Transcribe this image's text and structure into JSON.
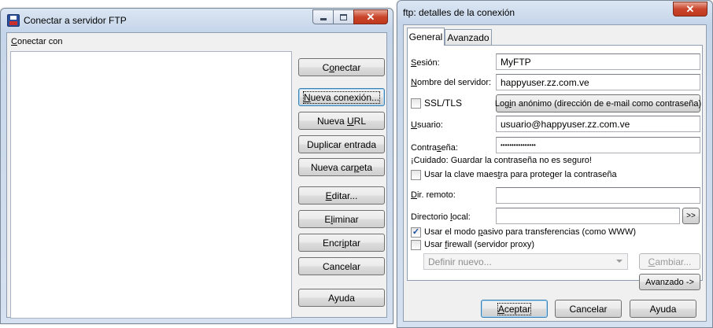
{
  "win1": {
    "title": "Conectar a servidor FTP",
    "connect_with_label_u": "C",
    "connect_with_label_rest": "onectar con",
    "buttons": {
      "connect": {
        "pre": "C",
        "u": "o",
        "post": "nectar"
      },
      "new_connection": {
        "pre": "",
        "u": "N",
        "post": "ueva conexión..."
      },
      "new_url": {
        "pre": "Nueva ",
        "u": "U",
        "post": "RL"
      },
      "duplicate": {
        "pre": "",
        "u": "",
        "post": "Duplicar entrada"
      },
      "new_folder": {
        "pre": "Nueva car",
        "u": "p",
        "post": "eta"
      },
      "edit": {
        "pre": "",
        "u": "E",
        "post": "ditar..."
      },
      "delete": {
        "pre": "E",
        "u": "l",
        "post": "iminar"
      },
      "encrypt": {
        "pre": "Encr",
        "u": "i",
        "post": "ptar"
      },
      "cancel": {
        "pre": "",
        "u": "",
        "post": "Cancelar"
      },
      "help": {
        "pre": "",
        "u": "",
        "post": "Ayuda"
      }
    }
  },
  "win2": {
    "title": "ftp: detalles de la conexión",
    "tabs": {
      "general": "General",
      "advanced": "Avanzado"
    },
    "session": {
      "label_u": "S",
      "label_rest": "esión:",
      "value": "MyFTP"
    },
    "server": {
      "label_u": "N",
      "label_rest": "ombre del servidor:",
      "value": "happyuser.zz.com.ve"
    },
    "ssl": {
      "label": "SSL/TLS",
      "checked": false
    },
    "anon_button": {
      "pre": "Log",
      "u": "i",
      "post": "n anónimo (dirección de e-mail como contraseña)"
    },
    "user": {
      "label_u": "U",
      "label_rest": "suario:",
      "value": "usuario@happyuser.zz.com.ve"
    },
    "password": {
      "label_pre": "Contra",
      "label_u": "s",
      "label_post": "eña:",
      "value": "••••••••••••••••"
    },
    "warning": "¡Cuidado: Guardar la contraseña no es seguro!",
    "master_key": {
      "pre": "Usar la clave maes",
      "u": "t",
      "post": "ra para proteger la contraseña",
      "checked": false
    },
    "remote_dir": {
      "label_u": "D",
      "label_rest": "ir. remoto:",
      "value": ""
    },
    "local_dir": {
      "label_pre": "Directorio ",
      "label_u": "l",
      "label_post": "ocal:",
      "value": ""
    },
    "browse_button": ">>",
    "passive": {
      "pre": "Usar el modo ",
      "u": "p",
      "post": "asivo para transferencias (como WWW)",
      "checked": true
    },
    "firewall": {
      "pre": "Usar ",
      "u": "f",
      "post": "irewall (servidor proxy)",
      "checked": false
    },
    "proxy_select": "Definir nuevo...",
    "change_button": {
      "pre": "",
      "u": "C",
      "post": "ambiar..."
    },
    "advanced_button": "Avanzado ->",
    "accept_button": {
      "pre": "",
      "u": "A",
      "post": "ceptar"
    },
    "cancel_button": "Cancelar",
    "help_button": "Ayuda"
  }
}
